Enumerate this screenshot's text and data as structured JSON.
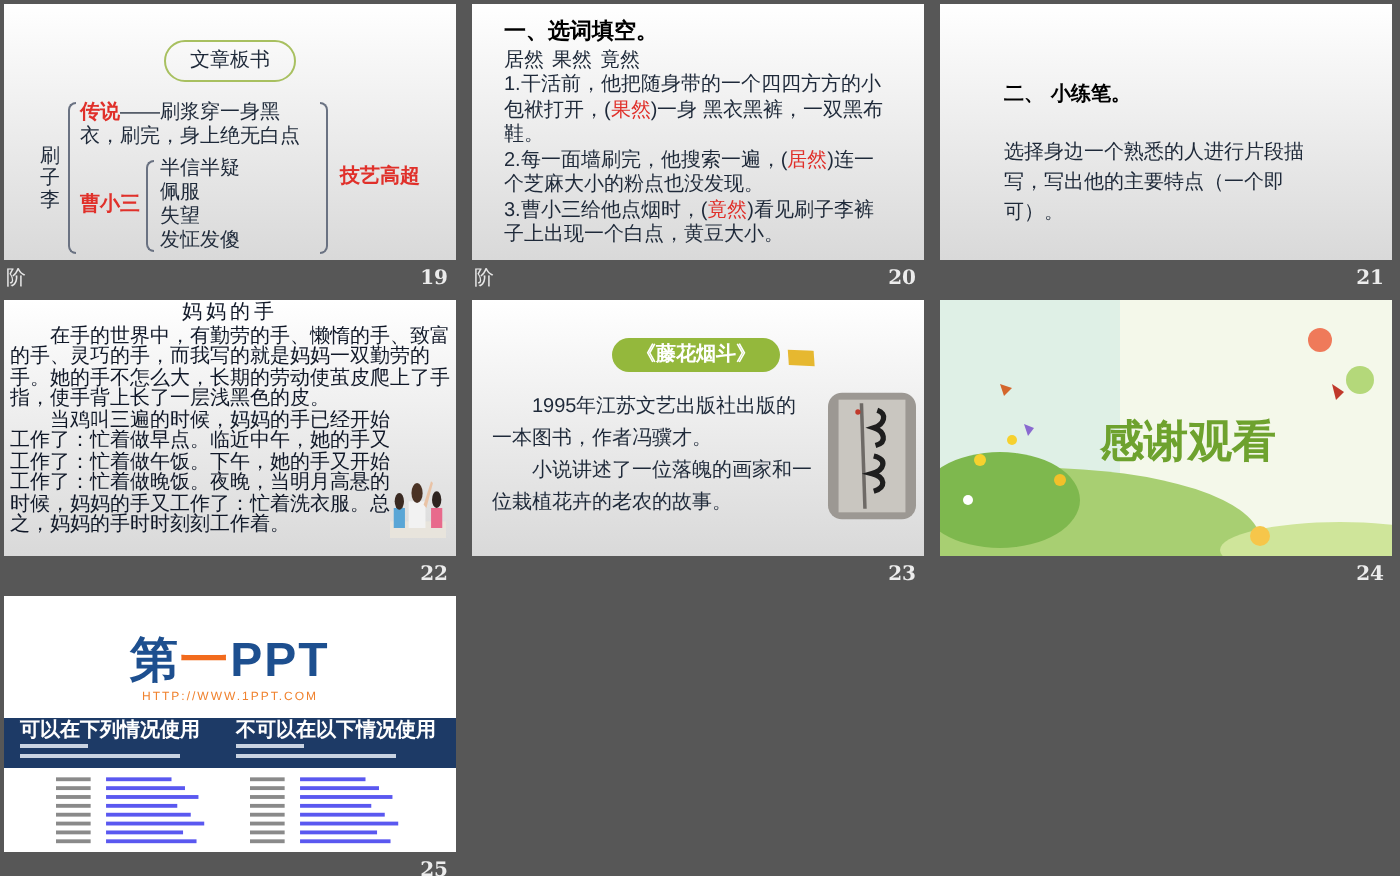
{
  "slides": [
    {
      "kind": "board",
      "number": "19",
      "section_mark": "阶",
      "title": "文章板书",
      "subject": "刷子李",
      "legend": {
        "label": "传说",
        "text": "——刷浆穿一身黑衣，刷完，身上绝无白点"
      },
      "witness": {
        "label": "曹小三",
        "reactions": [
          "半信半疑",
          "佩服",
          "失望",
          "发怔发傻"
        ]
      },
      "conclusion": "技艺高超"
    },
    {
      "kind": "exercise",
      "number": "20",
      "section_mark": "阶",
      "title": "一、选词填空。",
      "choices": [
        "居然",
        "果然",
        "竟然"
      ],
      "sentences": [
        {
          "before": "1.干活前，他把随身带的一个四四方方的小包袱打开，(",
          "answer": "果然",
          "after": ")一身 黑衣黑裤，一双黑布鞋。"
        },
        {
          "before": "2.每一面墙刷完，他搜索一遍，(",
          "answer": "居然",
          "after": ")连一个芝麻大小的粉点也没发现。"
        },
        {
          "before": "3.曹小三给他点烟时，(",
          "answer": "竟然",
          "after": ")看见刷子李裤子上出现一个白点，黄豆大小。"
        }
      ]
    },
    {
      "kind": "task",
      "number": "21",
      "title": "二、 小练笔。",
      "text": "选择身边一个熟悉的人进行片段描写，写出他的主要特点（一个即可）。"
    },
    {
      "kind": "essay",
      "number": "22",
      "title": "妈妈的手",
      "paragraphs": [
        "在手的世界中，有勤劳的手、懒惰的手、致富的手、灵巧的手，而我写的就是妈妈一双勤劳的手。她的手不怎么大，长期的劳动使茧皮爬上了手指，使手背上长了一层浅黑色的皮。",
        "当鸡叫三遍的时候，妈妈的手已经开始工作了：忙着做早点。临近中午，她的手又工作了：忙着做午饭。下午，她的手又开始工作了：忙着做晚饭。夜晚，当明月高悬的时候，妈妈的手又工作了：忙着洗衣服。总之，妈妈的手时时刻刻工作着。"
      ],
      "picture": {
        "kind": "picture"
      }
    },
    {
      "kind": "book",
      "number": "23",
      "title": "《藤花烟斗》",
      "paragraphs": [
        "1995年江苏文艺出版社出版的一本图书，作者冯骥才。",
        "小说讲述了一位落魄的画家和一位栽植花卉的老农的故事。"
      ],
      "picture": {
        "kind": "picture"
      }
    },
    {
      "kind": "closing",
      "number": "24",
      "text": "感谢观看",
      "picture": {
        "kind": "picture"
      }
    },
    {
      "kind": "brand",
      "number": "25",
      "logo": {
        "main": "第",
        "dash": "一",
        "latin": "PPT"
      },
      "url": "HTTP://WWW.1PPT.COM",
      "allowed": {
        "title": "可以在下列情况使用"
      },
      "forbidden": {
        "title": "不可以在以下情况使用"
      }
    }
  ]
}
